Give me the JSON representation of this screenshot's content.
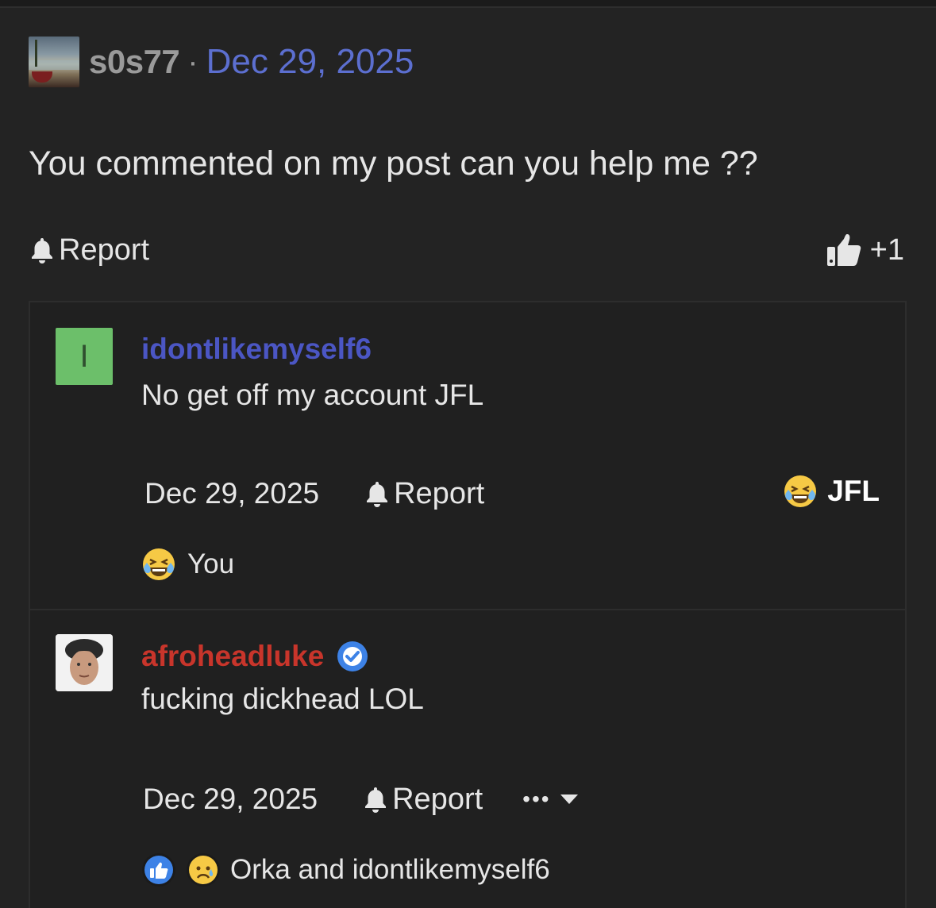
{
  "post": {
    "username": "s0s77",
    "separator": "·",
    "date": "Dec 29, 2025",
    "body": "You commented on my post can you help me ??",
    "report_label": "Report",
    "like_count": "+1"
  },
  "replies": [
    {
      "avatar_letter": "I",
      "username": "idontlikemyself6",
      "text": "No get off my account JFL",
      "date": "Dec 29, 2025",
      "report_label": "Report",
      "reaction_tag": "JFL",
      "reactions_text": "You"
    },
    {
      "username": "afroheadluke",
      "verified": true,
      "text": "fucking dickhead LOL",
      "date": "Dec 29, 2025",
      "report_label": "Report",
      "more_label": "•••",
      "reactions_text": "Orka and idontlikemyself6"
    }
  ],
  "colors": {
    "background": "#232323",
    "date_link": "#5c6fd0",
    "username_blue": "#4b56c4",
    "username_red": "#c8352b",
    "verified": "#3d82e6"
  },
  "icons": [
    "bell-icon",
    "thumbs-up-icon",
    "laughing-crying-emoji-icon",
    "verified-check-icon",
    "chevron-down-icon",
    "like-reaction-icon",
    "sad-reaction-icon"
  ]
}
